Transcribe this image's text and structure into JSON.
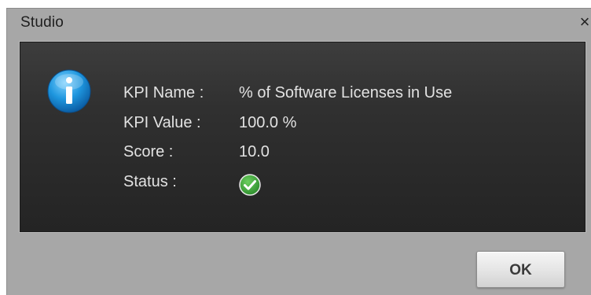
{
  "window": {
    "title": "Studio",
    "close_glyph": "×"
  },
  "icons": {
    "info": "info-icon",
    "status": "check-circle-icon"
  },
  "colors": {
    "info_icon": "#1a8fd6",
    "status_ok": "#3aa63a"
  },
  "kpi": {
    "name_label": "KPI Name :",
    "name_value": "% of Software Licenses in Use",
    "value_label": "KPI Value :",
    "value_value": "100.0 %",
    "score_label": "Score :",
    "score_value": "10.0",
    "status_label": "Status :"
  },
  "buttons": {
    "ok_label": "OK"
  }
}
